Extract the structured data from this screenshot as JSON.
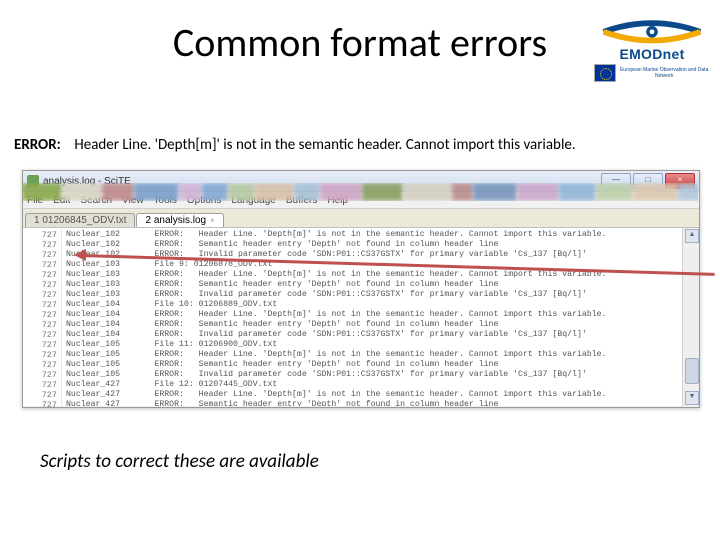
{
  "title": "Common format errors",
  "error_label": "ERROR:",
  "error_text": "Header Line. 'Depth[m]' is not in the semantic header. Cannot import this variable.",
  "footer_note": "Scripts to correct these are available",
  "logo": {
    "name": "EMODnet",
    "subtitle": "European Marine Observation and Data Network"
  },
  "editor": {
    "window_title": "analysis.log - SciTE",
    "menu": [
      "File",
      "Edit",
      "Search",
      "View",
      "Tools",
      "Options",
      "Language",
      "Buffers",
      "Help"
    ],
    "tabs": [
      {
        "label": "1 01206845_ODV.txt",
        "active": false
      },
      {
        "label": "2 analysis.log",
        "active": true
      }
    ],
    "win_buttons": {
      "min": "—",
      "max": "□",
      "close": "×"
    },
    "gutter_lines": [
      "727",
      "727",
      "727",
      "727",
      "727",
      "727",
      "727",
      "727",
      "727",
      "727",
      "727",
      "727",
      "727",
      "727",
      "727",
      "727",
      "727",
      "727"
    ],
    "code_lines": [
      "Nuclear_102       ERROR:   Header Line. 'Depth[m]' is not in the semantic header. Cannot import this variable.",
      "Nuclear_102       ERROR:   Semantic header entry 'Depth' not found in column header line",
      "Nuclear_102       ERROR:   Invalid parameter code 'SDN:P01::CS37GSTX' for primary variable 'Cs_137 [Bq/l]'",
      "Nuclear_103       File 9: 01206878_ODV.txt",
      "Nuclear_103       ERROR:   Header Line. 'Depth[m]' is not in the semantic header. Cannot import this variable.",
      "Nuclear_103       ERROR:   Semantic header entry 'Depth' not found in column header line",
      "Nuclear_103       ERROR:   Invalid parameter code 'SDN:P01::CS37GSTX' for primary variable 'Cs_137 [Bq/l]'",
      "Nuclear_104       File 10: 01206889_ODV.txt",
      "Nuclear_104       ERROR:   Header Line. 'Depth[m]' is not in the semantic header. Cannot import this variable.",
      "Nuclear_104       ERROR:   Semantic header entry 'Depth' not found in column header line",
      "Nuclear_104       ERROR:   Invalid parameter code 'SDN:P01::CS37GSTX' for primary variable 'Cs_137 [Bq/l]'",
      "Nuclear_105       File 11: 01206900_ODV.txt",
      "Nuclear_105       ERROR:   Header Line. 'Depth[m]' is not in the semantic header. Cannot import this variable.",
      "Nuclear_105       ERROR:   Semantic header entry 'Depth' not found in column header line",
      "Nuclear_105       ERROR:   Invalid parameter code 'SDN:P01::CS37GSTX' for primary variable 'Cs_137 [Bq/l]'",
      "Nuclear_427       File 12: 01207445_ODV.txt",
      "Nuclear_427       ERROR:   Header Line. 'Depth[m]' is not in the semantic header. Cannot import this variable.",
      "Nuclear_427       ERROR:   Semantic header entry 'Depth' not found in column header line"
    ]
  }
}
